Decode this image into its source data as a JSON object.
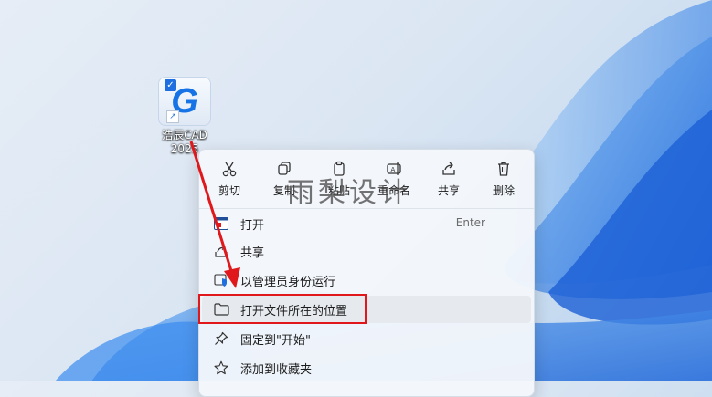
{
  "desktop_icon": {
    "label_line1": "浩辰CAD",
    "label_line2": "2025",
    "logo_letter": "G"
  },
  "context_menu": {
    "quick_actions": [
      {
        "name": "cut",
        "label": "剪切"
      },
      {
        "name": "copy",
        "label": "复制"
      },
      {
        "name": "paste",
        "label": "粘贴"
      },
      {
        "name": "rename",
        "label": "重命名"
      },
      {
        "name": "share",
        "label": "共享"
      },
      {
        "name": "delete",
        "label": "删除"
      }
    ],
    "items": [
      {
        "name": "open",
        "label": "打开",
        "shortcut": "Enter"
      },
      {
        "name": "share",
        "label": "共享"
      },
      {
        "name": "run-as-admin",
        "label": "以管理员身份运行"
      },
      {
        "name": "open-file-location",
        "label": "打开文件所在的位置"
      },
      {
        "name": "pin-to-start",
        "label": "固定到\"开始\""
      },
      {
        "name": "add-to-favorites",
        "label": "添加到收藏夹"
      }
    ]
  },
  "watermark": "雨梨设计",
  "colors": {
    "highlight": "#e0181b",
    "accent": "#1f6fe0"
  }
}
